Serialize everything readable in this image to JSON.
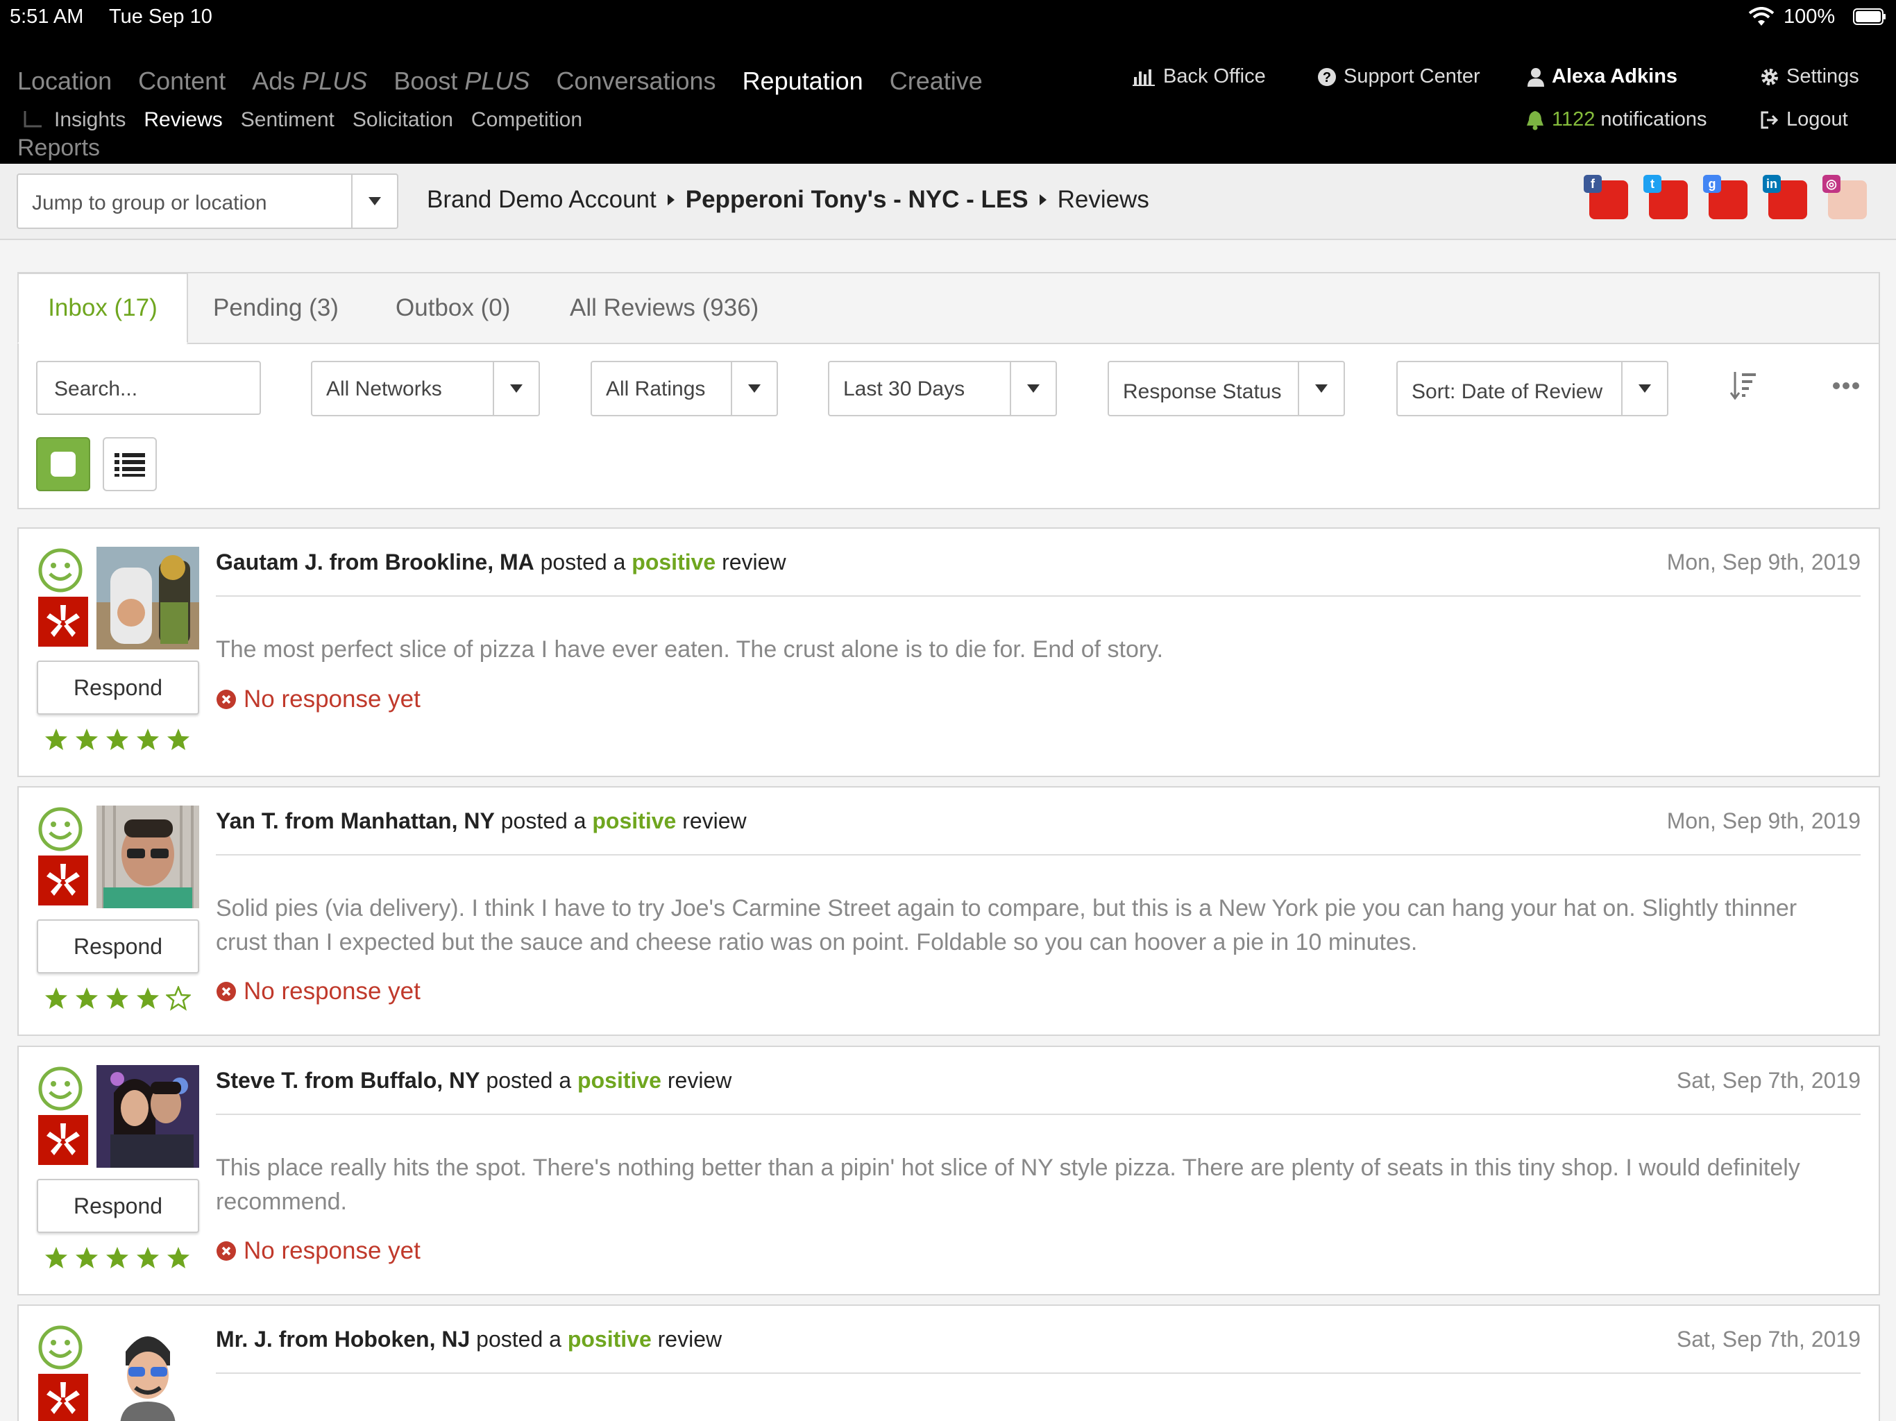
{
  "status_bar": {
    "time": "5:51 AM",
    "date": "Tue Sep 10",
    "battery": "100%"
  },
  "nav": {
    "main": [
      {
        "label": "Location",
        "suffix": ""
      },
      {
        "label": "Content",
        "suffix": ""
      },
      {
        "label": "Ads",
        "suffix": "PLUS"
      },
      {
        "label": "Boost",
        "suffix": "PLUS"
      },
      {
        "label": "Conversations",
        "suffix": ""
      },
      {
        "label": "Reputation",
        "suffix": ""
      },
      {
        "label": "Creative",
        "suffix": ""
      }
    ],
    "sub": [
      "Insights",
      "Reviews",
      "Sentiment",
      "Solicitation",
      "Competition"
    ],
    "reports": "Reports",
    "back_office": "Back Office",
    "support_center": "Support Center",
    "user_name": "Alexa Adkins",
    "notifications_count": "1122",
    "notifications_label": "notifications",
    "settings": "Settings",
    "logout": "Logout"
  },
  "crumbbar": {
    "jump_placeholder": "Jump to group or location",
    "crumbs": [
      "Brand Demo Account",
      "Pepperoni Tony's - NYC - LES",
      "Reviews"
    ]
  },
  "social_badges": [
    {
      "icon": "facebook-icon",
      "letter": "f",
      "color": "#3b5998"
    },
    {
      "icon": "twitter-icon",
      "letter": "t",
      "color": "#1da1f2"
    },
    {
      "icon": "google-my-business-icon",
      "letter": "g",
      "color": "#4285f4"
    },
    {
      "icon": "linkedin-icon",
      "letter": "in",
      "color": "#0077b5"
    },
    {
      "icon": "instagram-icon",
      "letter": "◎",
      "color": "#c13584"
    }
  ],
  "tabs": [
    "Inbox (17)",
    "Pending (3)",
    "Outbox (0)",
    "All Reviews (936)"
  ],
  "filters": {
    "search_placeholder": "Search...",
    "networks": "All Networks",
    "ratings": "All Ratings",
    "range": "Last 30 Days",
    "response_status": "Response Status",
    "sort": "Sort: Date of Review"
  },
  "card_common": {
    "posted_a": "posted a",
    "review_word": "review",
    "respond": "Respond",
    "no_response": "No response yet"
  },
  "reviews": [
    {
      "reviewer": "Gautam J. from Brookline, MA",
      "sentiment": "positive",
      "date": "Mon, Sep 9th, 2019",
      "text": "The most perfect slice of pizza I have ever eaten. The crust alone is to die for. End of story.",
      "rating": 5
    },
    {
      "reviewer": "Yan T. from Manhattan, NY",
      "sentiment": "positive",
      "date": "Mon, Sep 9th, 2019",
      "text": "Solid pies (via delivery). I think I have to try Joe's Carmine Street again to compare, but this is a New York pie you can hang your hat on. Slightly thinner crust than I expected but the sauce and cheese ratio was on point. Foldable so you can hoover a pie in 10 minutes.",
      "rating": 4
    },
    {
      "reviewer": "Steve T. from Buffalo, NY",
      "sentiment": "positive",
      "date": "Sat, Sep 7th, 2019",
      "text": "This place really hits the spot. There's nothing better than a pipin' hot slice of NY style pizza. There are plenty of seats in this tiny shop. I would definitely recommend.",
      "rating": 5
    },
    {
      "reviewer": "Mr. J. from Hoboken, NJ",
      "sentiment": "positive",
      "date": "Sat, Sep 7th, 2019"
    }
  ],
  "colors": {
    "accent_green": "#6fa61f",
    "no_response_red": "#c0392b",
    "yelp_red": "#c41200",
    "nav_bg": "#000000"
  }
}
